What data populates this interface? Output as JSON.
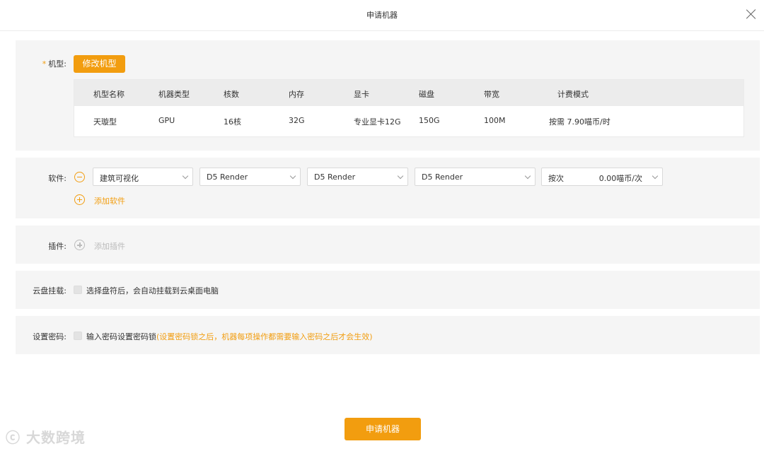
{
  "dialog": {
    "title": "申请机器",
    "close_icon": "close-icon"
  },
  "machine": {
    "label": "机型:",
    "required_mark": "*",
    "modify_button": "修改机型",
    "table": {
      "headers": [
        "机型名称",
        "机器类型",
        "核数",
        "内存",
        "显卡",
        "磁盘",
        "带宽",
        "计费模式"
      ],
      "row": [
        "天璇型",
        "GPU",
        "16核",
        "32G",
        "专业显卡12G",
        "150G",
        "100M",
        "按需 7.90喵币/时"
      ]
    }
  },
  "software": {
    "label": "软件:",
    "remove_icon": "minus-circle-icon",
    "selects": [
      "建筑可视化",
      "D5 Render",
      "D5 Render",
      "D5 Render"
    ],
    "billing": {
      "mode": "按次",
      "price": "0.00喵币/次"
    },
    "add_icon": "plus-circle-icon",
    "add_label": "添加软件"
  },
  "plugin": {
    "label": "插件:",
    "add_icon": "plus-circle-icon",
    "add_label": "添加插件"
  },
  "cloud_disk": {
    "label": "云盘挂载:",
    "checkbox_text": "选择盘符后，会自动挂载到云桌面电脑"
  },
  "password": {
    "label": "设置密码:",
    "checkbox_text": "输入密码设置密码锁",
    "hint": "(设置密码锁之后，机器每项操作都需要输入密码之后才会生效)"
  },
  "footer": {
    "submit_button": "申请机器"
  },
  "watermark": "大数跨境",
  "colors": {
    "accent": "#f29d0f",
    "panel": "#f5f5f5",
    "table_header": "#ececec"
  }
}
